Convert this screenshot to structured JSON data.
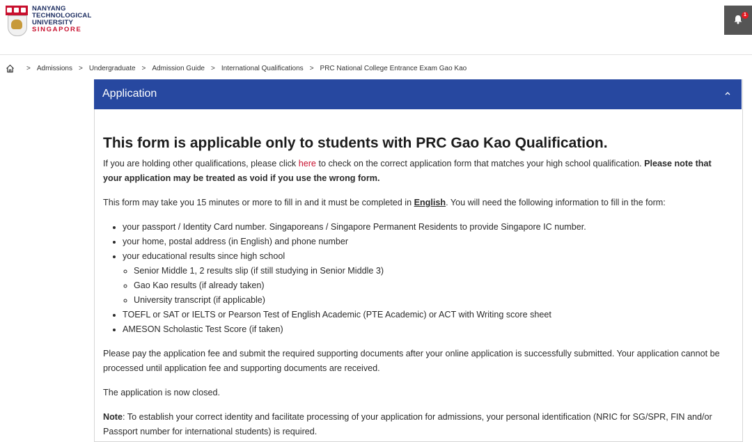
{
  "header": {
    "logo_lines": [
      "NANYANG",
      "TECHNOLOGICAL",
      "UNIVERSITY",
      "SINGAPORE"
    ],
    "notification_count": "1",
    "brand_color": "#c8102e"
  },
  "breadcrumb": {
    "items": [
      "Admissions",
      "Undergraduate",
      "Admission Guide",
      "International Qualifications",
      "PRC National College Entrance Exam Gao Kao"
    ],
    "separator": ">"
  },
  "accordion": {
    "title": "Application",
    "header_color": "#2748a0"
  },
  "content": {
    "heading": "This form is applicable only to students with PRC Gao Kao Qualification.",
    "intro_before_link": "If you are holding other qualifications, please click ",
    "intro_link": "here",
    "intro_after_link": " to check on the correct application form that matches your high school qualification. ",
    "intro_note": "Please note that your application may be treated as void if you use the wrong form.",
    "time_before": "This form may take you 15 minutes or more to fill in and it must be completed in ",
    "time_language": "English",
    "time_after": ". You will need the following information to fill in the form:",
    "list": {
      "item1": "your passport / Identity Card number. Singaporeans / Singapore Permanent Residents to provide Singapore IC number.",
      "item2": "your home, postal address (in English) and phone number",
      "item3": "your educational results since high school",
      "sub": [
        "Senior Middle 1, 2 results slip (if still studying in Senior Middle 3)",
        "Gao Kao results (if already taken)",
        "University transcript (if applicable)"
      ],
      "item4": "TOEFL or SAT or IELTS or Pearson Test of English Academic (PTE Academic) or ACT with Writing score sheet",
      "item5": "AMESON Scholastic Test Score (if taken)"
    },
    "fee": "Please pay the application fee and submit the required supporting documents after your online application is successfully submitted.  Your application cannot be processed until application fee and supporting documents are received.",
    "closed": "The application is now closed.",
    "note_label": "Note",
    "note_text": ": To establish your correct identity and facilitate processing of your application for admissions, your personal identification (NRIC for SG/SPR, FIN and/or Passport number for international students) is required."
  }
}
